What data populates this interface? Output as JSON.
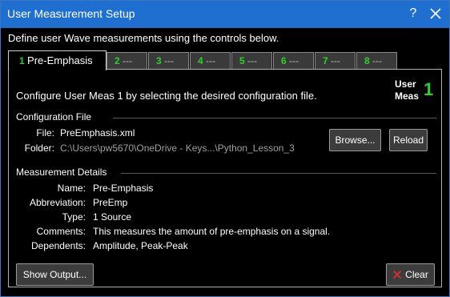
{
  "window": {
    "title": "User Measurement Setup",
    "help_glyph": "?"
  },
  "intro": "Define user Wave measurements using the controls below.",
  "tabs": [
    {
      "num": "1",
      "label": "Pre-Emphasis",
      "active": true
    },
    {
      "num": "2",
      "label": "---"
    },
    {
      "num": "3",
      "label": "---"
    },
    {
      "num": "4",
      "label": "---"
    },
    {
      "num": "5",
      "label": "---"
    },
    {
      "num": "6",
      "label": "---"
    },
    {
      "num": "7",
      "label": "---"
    },
    {
      "num": "8",
      "label": "---"
    }
  ],
  "panel": {
    "config_text": "Configure User Meas 1 by selecting the desired configuration file.",
    "user_meas_label_line1": "User",
    "user_meas_label_line2": "Meas",
    "user_meas_num": "1",
    "config_section": "Configuration File",
    "file_label": "File:",
    "file_value": "PreEmphasis.xml",
    "folder_label": "Folder:",
    "folder_value": "C:\\Users\\pw5670\\OneDrive - Keys...\\Python_Lesson_3",
    "browse_label": "Browse...",
    "reload_label": "Reload",
    "details_section": "Measurement Details",
    "details": [
      {
        "label": "Name:",
        "value": "Pre-Emphasis"
      },
      {
        "label": "Abbreviation:",
        "value": "PreEmp"
      },
      {
        "label": "Type:",
        "value": "1 Source"
      },
      {
        "label": "Comments:",
        "value": "This measures the amount of pre-emphasis on a signal."
      },
      {
        "label": "Dependents:",
        "value": "Amplitude,  Peak-Peak"
      }
    ],
    "show_output_label": "Show Output...",
    "clear_label": "Clear"
  },
  "colors": {
    "titlebar": "#1e6fd0",
    "accent_green": "#2bd12b",
    "clear_x": "#e03030"
  },
  "icons": {
    "close": "close-icon",
    "help": "help-icon",
    "clear": "clear-x-icon"
  }
}
